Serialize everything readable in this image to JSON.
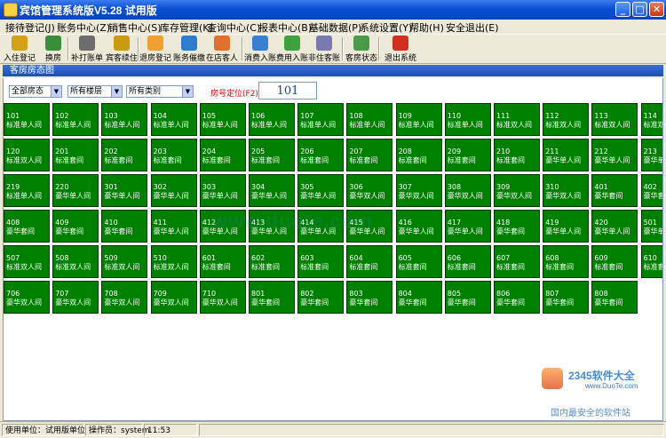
{
  "window": {
    "title": "宾馆管理系统版V5.28  试用版"
  },
  "menu": [
    "接待登记(J)",
    "账务中心(Z)",
    "销售中心(S)",
    "库存管理(K)",
    "查询中心(C)",
    "报表中心(B)",
    "基础数据(P)",
    "系统设置(Y)",
    "帮助(H)",
    "安全退出(E)"
  ],
  "toolbar": [
    {
      "label": "入住登记",
      "icon": "key-icon",
      "color": "#d4a017"
    },
    {
      "label": "换房",
      "icon": "exchange-icon",
      "color": "#3a8e3a"
    },
    {
      "label": "补打账单",
      "icon": "printer-icon",
      "color": "#6d6d6d"
    },
    {
      "label": "宾客续住",
      "icon": "key-icon",
      "color": "#c99a12"
    },
    {
      "label": "退房登记",
      "icon": "exit-arrow-icon",
      "color": "#f0a030"
    },
    {
      "label": "账务催缴",
      "icon": "money-icon",
      "color": "#2f7ccf"
    },
    {
      "label": "在店客人",
      "icon": "guests-icon",
      "color": "#e07030"
    },
    {
      "label": "消费入账",
      "icon": "house-icon",
      "color": "#3a7fd0"
    },
    {
      "label": "费用入账",
      "icon": "checkmark-icon",
      "color": "#3fa040"
    },
    {
      "label": "非住客账",
      "icon": "user-icon",
      "color": "#7a7ab0"
    },
    {
      "label": "客房状态",
      "icon": "chart-icon",
      "color": "#4a9a4a"
    },
    {
      "label": "退出系统",
      "icon": "close-x-icon",
      "color": "#d03020"
    }
  ],
  "panel_title": "客房房态图",
  "filters": {
    "status": "全部房态",
    "floor": "所有楼层",
    "category": "所有类别",
    "locate_label": "房号定位(F2)",
    "locate_value": "101"
  },
  "room_color": "#008000",
  "rooms": [
    [
      "101",
      "标准单人间"
    ],
    [
      "102",
      "标准单人间"
    ],
    [
      "103",
      "标准单人间"
    ],
    [
      "104",
      "标准单人间"
    ],
    [
      "105",
      "标准单人间"
    ],
    [
      "106",
      "标准单人间"
    ],
    [
      "107",
      "标准单人间"
    ],
    [
      "108",
      "标准单人间"
    ],
    [
      "109",
      "标准单人间"
    ],
    [
      "110",
      "标准单人间"
    ],
    [
      "111",
      "标准双人间"
    ],
    [
      "112",
      "标准双人间"
    ],
    [
      "113",
      "标准双人间"
    ],
    [
      "114",
      "标准双人间"
    ],
    [
      "120",
      "标准双人间"
    ],
    [
      "201",
      "标准套间"
    ],
    [
      "202",
      "标准套间"
    ],
    [
      "203",
      "标准套间"
    ],
    [
      "204",
      "标准套间"
    ],
    [
      "205",
      "标准套间"
    ],
    [
      "206",
      "标准套间"
    ],
    [
      "207",
      "标准套间"
    ],
    [
      "208",
      "标准套间"
    ],
    [
      "209",
      "标准套间"
    ],
    [
      "210",
      "标准套间"
    ],
    [
      "211",
      "豪华单人间"
    ],
    [
      "212",
      "豪华单人间"
    ],
    [
      "213",
      "豪华单人间"
    ],
    [
      "219",
      "标准单人间"
    ],
    [
      "220",
      "豪华单人间"
    ],
    [
      "301",
      "豪华单人间"
    ],
    [
      "302",
      "豪华单人间"
    ],
    [
      "303",
      "豪华单人间"
    ],
    [
      "304",
      "豪华单人间"
    ],
    [
      "305",
      "豪华单人间"
    ],
    [
      "306",
      "豪华双人间"
    ],
    [
      "307",
      "豪华双人间"
    ],
    [
      "308",
      "豪华双人间"
    ],
    [
      "309",
      "豪华双人间"
    ],
    [
      "310",
      "豪华双人间"
    ],
    [
      "401",
      "豪华套间"
    ],
    [
      "402",
      "豪华套间"
    ],
    [
      "408",
      "豪华套间"
    ],
    [
      "409",
      "豪华套间"
    ],
    [
      "410",
      "豪华套间"
    ],
    [
      "411",
      "豪华单人间"
    ],
    [
      "412",
      "豪华单人间"
    ],
    [
      "413",
      "豪华单人间"
    ],
    [
      "414",
      "豪华单人间"
    ],
    [
      "415",
      "豪华单人间"
    ],
    [
      "416",
      "豪华单人间"
    ],
    [
      "417",
      "豪华单人间"
    ],
    [
      "418",
      "豪华套间"
    ],
    [
      "419",
      "豪华单人间"
    ],
    [
      "420",
      "豪华单人间"
    ],
    [
      "501",
      "豪华单人间"
    ],
    [
      "507",
      "标准双人间"
    ],
    [
      "508",
      "标准双人间"
    ],
    [
      "509",
      "标准双人间"
    ],
    [
      "510",
      "标准双人间"
    ],
    [
      "601",
      "标准套间"
    ],
    [
      "602",
      "标准套间"
    ],
    [
      "603",
      "标准套间"
    ],
    [
      "604",
      "标准套间"
    ],
    [
      "605",
      "标准套间"
    ],
    [
      "606",
      "标准套间"
    ],
    [
      "607",
      "标准套间"
    ],
    [
      "608",
      "标准套间"
    ],
    [
      "609",
      "标准套间"
    ],
    [
      "610",
      "标准套间"
    ],
    [
      "706",
      "豪华双人间"
    ],
    [
      "707",
      "豪华双人间"
    ],
    [
      "708",
      "豪华双人间"
    ],
    [
      "709",
      "豪华双人间"
    ],
    [
      "710",
      "豪华双人间"
    ],
    [
      "801",
      "豪华套间"
    ],
    [
      "802",
      "豪华套间"
    ],
    [
      "803",
      "豪华套间"
    ],
    [
      "804",
      "豪华套间"
    ],
    [
      "805",
      "豪华套间"
    ],
    [
      "806",
      "豪华套间"
    ],
    [
      "807",
      "豪华套间"
    ],
    [
      "808",
      "豪华套间"
    ]
  ],
  "watermarks": {
    "center": "www.duote.com",
    "logo_text": "2345软件大全",
    "logo_url": "www.DuoTe.com",
    "slogan": "国内最安全的软件站"
  },
  "status": {
    "unit": "使用单位：试用版单位",
    "operator": "操作员：system",
    "time": "11:53"
  }
}
